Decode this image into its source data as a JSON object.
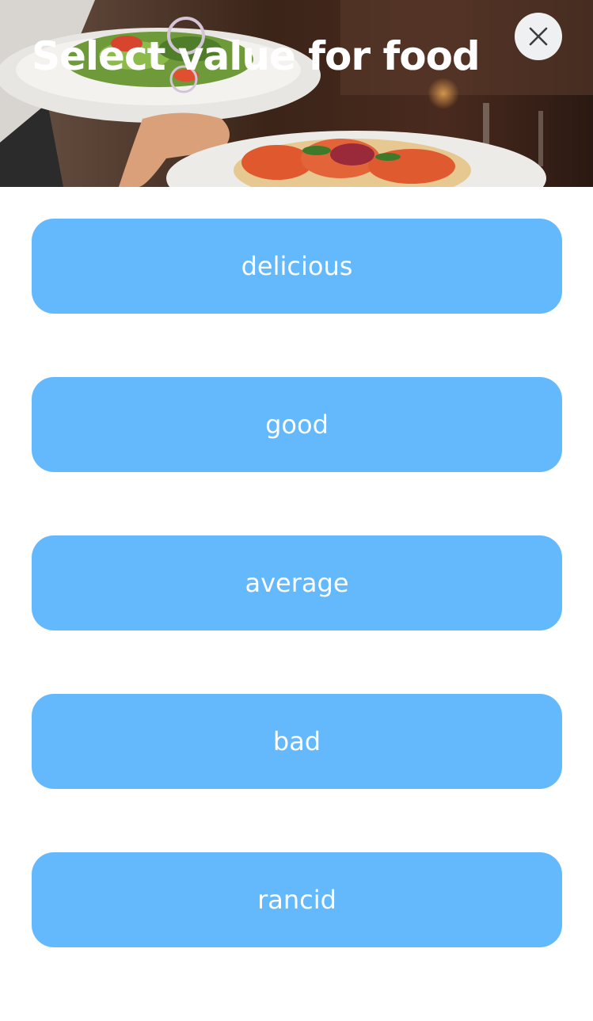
{
  "header": {
    "title": "Select value for food",
    "background_image": "restaurant-food-plates-photo",
    "close_icon": "close-icon"
  },
  "options": [
    {
      "label": "delicious"
    },
    {
      "label": "good"
    },
    {
      "label": "average"
    },
    {
      "label": "bad"
    },
    {
      "label": "rancid"
    }
  ],
  "colors": {
    "option_background": "#64b8fc",
    "option_text": "#ffffff",
    "title_text": "#ffffff",
    "close_button_background": "#eef0f2",
    "close_icon": "#3c3c3c",
    "page_background": "#ffffff"
  }
}
